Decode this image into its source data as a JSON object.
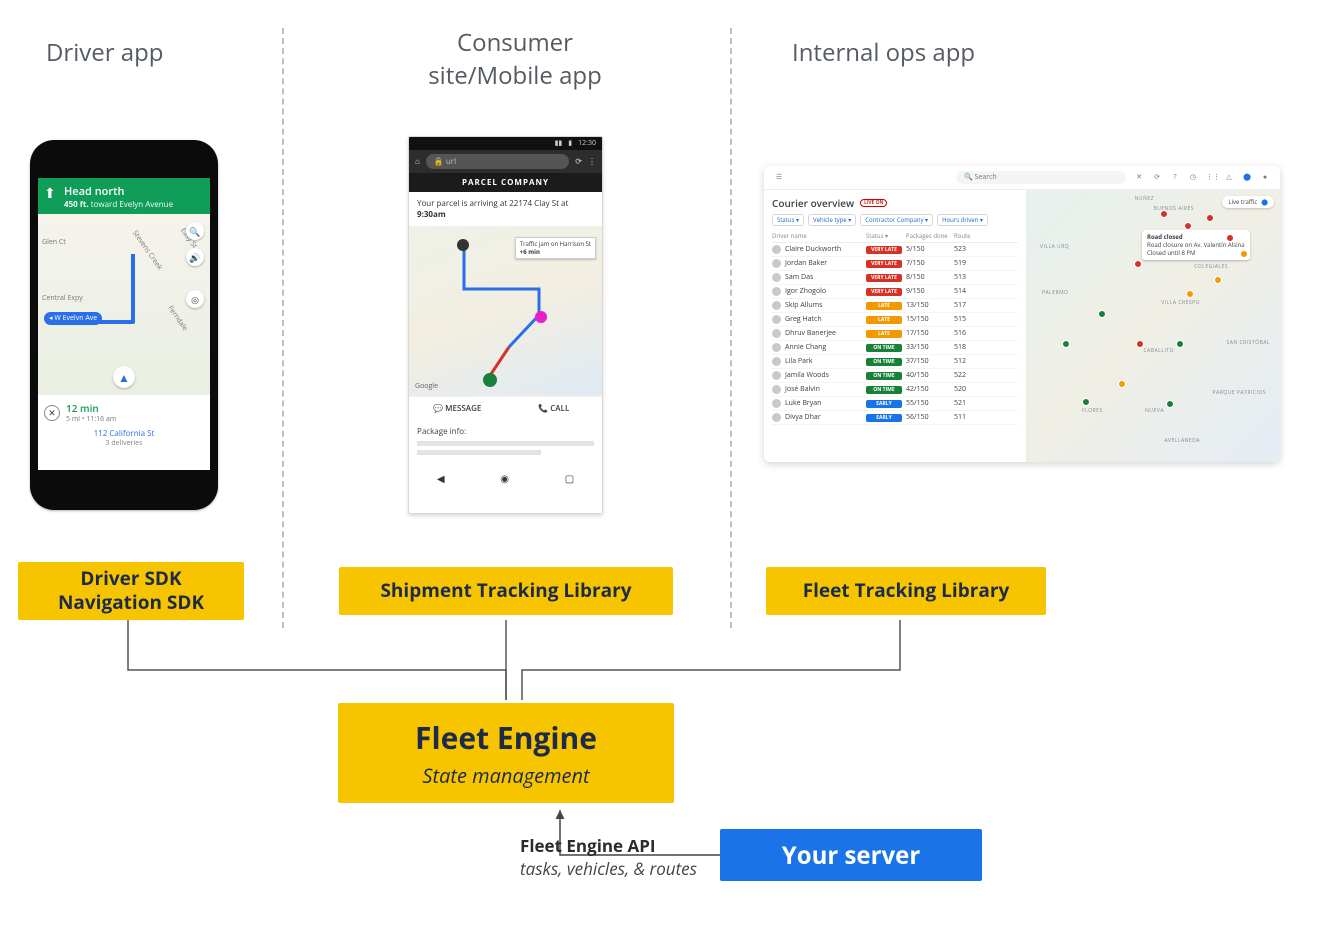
{
  "columns": {
    "driver": "Driver app",
    "consumer_l1": "Consumer",
    "consumer_l2": "site/Mobile app",
    "ops": "Internal ops app"
  },
  "sdk_boxes": {
    "driver_l1": "Driver SDK",
    "driver_l2": "Navigation SDK",
    "shipment": "Shipment Tracking Library",
    "fleet": "Fleet Tracking Library"
  },
  "fleet_engine": {
    "title": "Fleet Engine",
    "subtitle": "State management"
  },
  "server_box": "Your server",
  "api_link": {
    "title": "Fleet Engine API",
    "subtitle": "tasks, vehicles, & routes"
  },
  "driver_app": {
    "instruction": "Head north",
    "distance": "450 ft.",
    "toward": "toward Evelyn Avenue",
    "map_labels": {
      "glen": "Glen Ct",
      "central": "Central Expy",
      "stevens": "Stevens Creek",
      "easy": "Easy St",
      "ferndale": "Ferndale"
    },
    "route_pill": "◂ W Evelyn Ave",
    "eta_time": "12 min",
    "eta_detail": "5 mi • 11:16 am",
    "dest": "112 California St",
    "dest_sub": "3 deliveries"
  },
  "consumer_app": {
    "status": {
      "sig": "▮▮",
      "batt": "▮",
      "time": "12:30"
    },
    "url_text": "url",
    "company": "PARCEL COMPANY",
    "arrival_pre": "Your parcel is arriving at 22174 Clay St at",
    "arrival_time": "9:30am",
    "traffic_tip_l1": "Traffic jam on Harrison St",
    "traffic_tip_l2": "+6 min",
    "google_logo": "Google",
    "actions": {
      "message": "MESSAGE",
      "call": "CALL"
    },
    "info_label": "Package info:",
    "nav": {
      "back": "◀",
      "home": "◉",
      "recent": "▢"
    }
  },
  "ops_app": {
    "search_placeholder": "Search",
    "title": "Courier overview",
    "live": "LIVE ON",
    "filters": [
      "Status ▾",
      "Vehicle type ▾",
      "Contractor Company ▾",
      "Hours driven ▾"
    ],
    "headers": [
      "Driver name",
      "Status ▾",
      "Packages done",
      "Route"
    ],
    "rows": [
      {
        "name": "Claire Duckworth",
        "status": "VERY LATE",
        "cls": "b-verylate",
        "pkg": "5/150",
        "route": "523"
      },
      {
        "name": "Jordan Baker",
        "status": "VERY LATE",
        "cls": "b-verylate",
        "pkg": "7/150",
        "route": "519"
      },
      {
        "name": "Sam Das",
        "status": "VERY LATE",
        "cls": "b-verylate",
        "pkg": "8/150",
        "route": "513"
      },
      {
        "name": "Igor Zhogolo",
        "status": "VERY LATE",
        "cls": "b-verylate",
        "pkg": "9/150",
        "route": "514"
      },
      {
        "name": "Skip Allums",
        "status": "LATE",
        "cls": "b-late",
        "pkg": "13/150",
        "route": "517"
      },
      {
        "name": "Greg Hatch",
        "status": "LATE",
        "cls": "b-late",
        "pkg": "15/150",
        "route": "515"
      },
      {
        "name": "Dhruv Banerjee",
        "status": "LATE",
        "cls": "b-late",
        "pkg": "17/150",
        "route": "516"
      },
      {
        "name": "Annie Chang",
        "status": "ON TIME",
        "cls": "b-ontime",
        "pkg": "33/150",
        "route": "518"
      },
      {
        "name": "Lila Park",
        "status": "ON TIME",
        "cls": "b-ontime",
        "pkg": "37/150",
        "route": "512"
      },
      {
        "name": "Jamila Woods",
        "status": "ON TIME",
        "cls": "b-ontime",
        "pkg": "40/150",
        "route": "522"
      },
      {
        "name": "José Balvin",
        "status": "ON TIME",
        "cls": "b-ontime",
        "pkg": "42/150",
        "route": "520"
      },
      {
        "name": "Luke Bryan",
        "status": "EARLY",
        "cls": "b-early",
        "pkg": "55/150",
        "route": "521"
      },
      {
        "name": "Divya Dhar",
        "status": "EARLY",
        "cls": "b-early",
        "pkg": "56/150",
        "route": "511"
      }
    ],
    "traffic_toggle": "Live traffic",
    "map_tooltip": {
      "title": "Road closed",
      "l1": "Road closure on Av. Valentín Alsina",
      "l2": "Closed until 8 PM"
    },
    "map_labels": [
      "NUÑEZ",
      "BUENOS AIRES",
      "VILLA URQ",
      "COLEGIALES",
      "VILLA CRESPO",
      "PALERMO",
      "CABALLITO",
      "SAN CRISTÓBAL",
      "FLORES",
      "NUEVA",
      "PARQUE PATRICIOS",
      "AVELLANEDA"
    ]
  }
}
